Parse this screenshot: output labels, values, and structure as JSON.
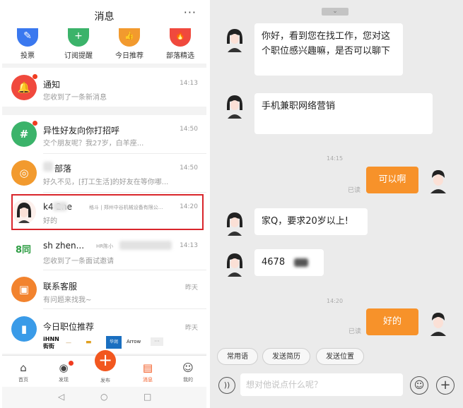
{
  "left": {
    "header": {
      "title": "消息",
      "more": "···"
    },
    "quick": [
      {
        "label": "投票",
        "color": "#3a78ef",
        "icon": "vote-icon",
        "glyph": "✎"
      },
      {
        "label": "订阅提醒",
        "color": "#3bb36a",
        "icon": "subscribe-icon",
        "glyph": "+"
      },
      {
        "label": "今日推荐",
        "color": "#f29a2e",
        "icon": "thumb-up-icon",
        "glyph": "👍"
      },
      {
        "label": "部落精选",
        "color": "#f0493d",
        "icon": "flame-icon",
        "glyph": "🔥"
      }
    ],
    "messages": [
      {
        "title": "通知",
        "sub": "您收到了一条新消息",
        "time": "14:13",
        "color": "#f0493d",
        "glyph": "🔔",
        "icon": "bell-icon"
      },
      {
        "title": "异性好友向你打招呼",
        "sub": "交个朋友呢？我27岁，白羊座...",
        "time": "14:50",
        "color": "#3bb36a",
        "glyph": "#",
        "icon": "hashtag-icon"
      },
      {
        "title": "部落",
        "sub": "好久不见，[打工生活]的好友在等你哪...",
        "time": "14:50",
        "color": "#f29a2e",
        "glyph": "◎",
        "icon": "tribe-icon"
      },
      {
        "title": "k4   2ne",
        "tag": "格斗 | 郑州中谷机械设备有限公...",
        "sub": "好的",
        "time": "14:20",
        "color": "#ffffff",
        "glyph": "",
        "icon": "avatar-icon"
      },
      {
        "title": "sh   zhen...",
        "tag": "HR陈小",
        "sub": "您收到了一条面试邀请",
        "time": "14:13",
        "color": "#ffffff",
        "glyph": "8同",
        "icon": "58-logo-icon"
      },
      {
        "title": "联系客服",
        "sub": "有问题来找我~",
        "time": "昨天",
        "color": "#f2832e",
        "glyph": "▣",
        "icon": "service-icon"
      },
      {
        "title": "今日职位推荐",
        "sub": "",
        "time": "昨天",
        "color": "#3a9be8",
        "glyph": "▮",
        "icon": "job-icon"
      }
    ],
    "logos": [
      "iHNN 街街",
      "—",
      "▬",
      "华润",
      "Arrow",
      "···"
    ],
    "tabs": [
      {
        "label": "首页",
        "glyph": "⌂",
        "icon": "home-icon"
      },
      {
        "label": "发现",
        "glyph": "◉",
        "icon": "discover-icon"
      },
      {
        "label": "发布",
        "glyph": "",
        "icon": "publish-icon"
      },
      {
        "label": "消息",
        "glyph": "▤",
        "icon": "message-icon"
      },
      {
        "label": "我的",
        "glyph": "☺",
        "icon": "profile-icon"
      }
    ],
    "publish_glyph": "+",
    "nav": {
      "back": "◁",
      "home": "○",
      "recent": "□"
    }
  },
  "right": {
    "top_handle": "⌄",
    "chat": [
      {
        "side": "left",
        "text": "你好，看到您在找工作，您对这个职位感兴趣嘛，是否可以聊下"
      },
      {
        "side": "left",
        "text": "手机兼职网络营销"
      },
      {
        "side": "time",
        "text": "14:15"
      },
      {
        "side": "right",
        "text": "可以啊",
        "read": "已读"
      },
      {
        "side": "left",
        "text": "家Q，要求20岁以上!"
      },
      {
        "side": "left",
        "text": "4678"
      },
      {
        "side": "time",
        "text": "14:20"
      },
      {
        "side": "right",
        "text": "好的",
        "read": "已读"
      }
    ],
    "quick_replies": [
      "常用语",
      "发送简历",
      "发送位置"
    ],
    "input": {
      "placeholder": "想对他说点什么呢？",
      "voice": "))",
      "emoji": "☺",
      "plus": "+"
    }
  }
}
